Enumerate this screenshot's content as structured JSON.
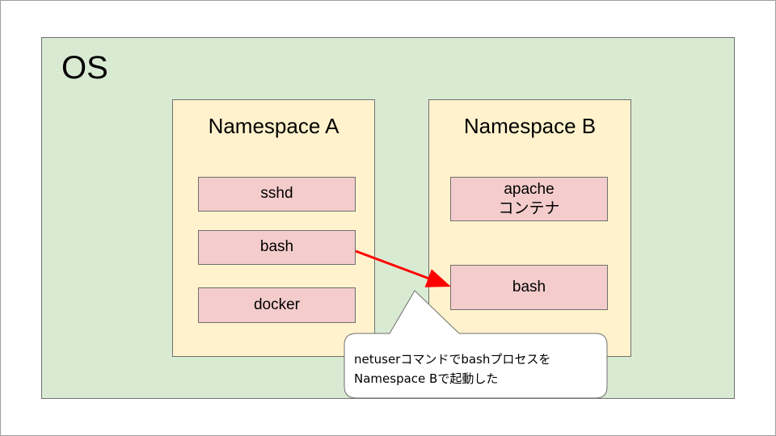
{
  "os": {
    "label": "OS"
  },
  "namespaces": {
    "a": {
      "title": "Namespace A",
      "processes": [
        "sshd",
        "bash",
        "docker"
      ]
    },
    "b": {
      "title": "Namespace B",
      "apache": {
        "line1": "apache",
        "line2": "コンテナ"
      },
      "bash": "bash"
    }
  },
  "callout": {
    "line1": "netuserコマンドでbashプロセスを",
    "line2": "Namespace Bで起動した"
  },
  "colors": {
    "os_fill": "#d9ead3",
    "namespace_fill": "#fff2cc",
    "process_fill": "#f4cccc",
    "arrow": "#ff0000"
  }
}
